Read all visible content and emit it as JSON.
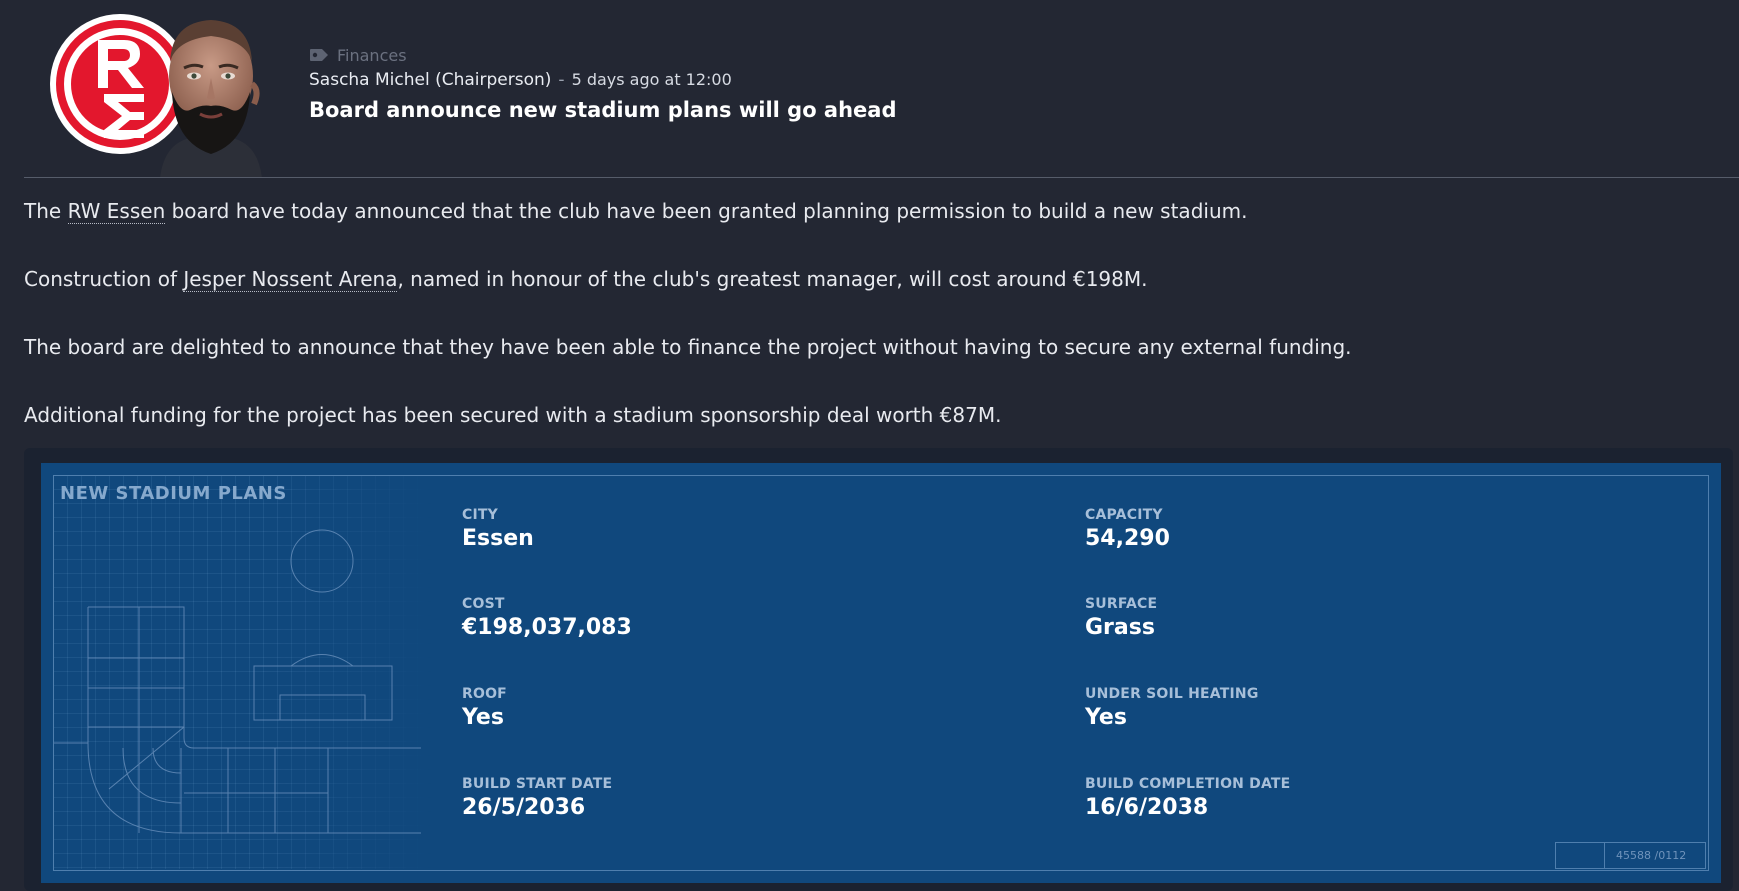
{
  "message": {
    "category": "Finances",
    "sender": "Sascha Michel (Chairperson)",
    "separator": "-",
    "time": "5 days ago at 12:00",
    "headline": "Board announce new stadium plans will go ahead"
  },
  "body": {
    "p1": {
      "pre": "The ",
      "link": "RW Essen",
      "post": " board have today announced that the club have been granted planning permission to build a new stadium."
    },
    "p2": {
      "pre": "Construction of ",
      "link": "Jesper Nossent Arena",
      "post": ", named in honour of the club's greatest manager, will cost around €198M."
    },
    "p3": "The board are delighted to announce that they have been able to finance the project without having to secure any external funding.",
    "p4": "Additional funding for the project has been secured with a stadium sponsorship deal worth €87M."
  },
  "stadium": {
    "title": "NEW STADIUM PLANS",
    "city": {
      "label": "CITY",
      "value": "Essen"
    },
    "capacity": {
      "label": "CAPACITY",
      "value": "54,290"
    },
    "cost": {
      "label": "COST",
      "value": "€198,037,083"
    },
    "surface": {
      "label": "SURFACE",
      "value": "Grass"
    },
    "roof": {
      "label": "ROOF",
      "value": "Yes"
    },
    "heating": {
      "label": "UNDER SOIL HEATING",
      "value": "Yes"
    },
    "start": {
      "label": "BUILD START DATE",
      "value": "26/5/2036"
    },
    "completion": {
      "label": "BUILD COMPLETION DATE",
      "value": "16/6/2038"
    },
    "ref_code": "45588 /0112"
  },
  "colors": {
    "background": "#232733",
    "card": "#10487d",
    "crest_red": "#e3172d"
  },
  "icons": {
    "category": "tag-icon",
    "crest": "club-crest",
    "avatar": "chairperson-avatar"
  }
}
